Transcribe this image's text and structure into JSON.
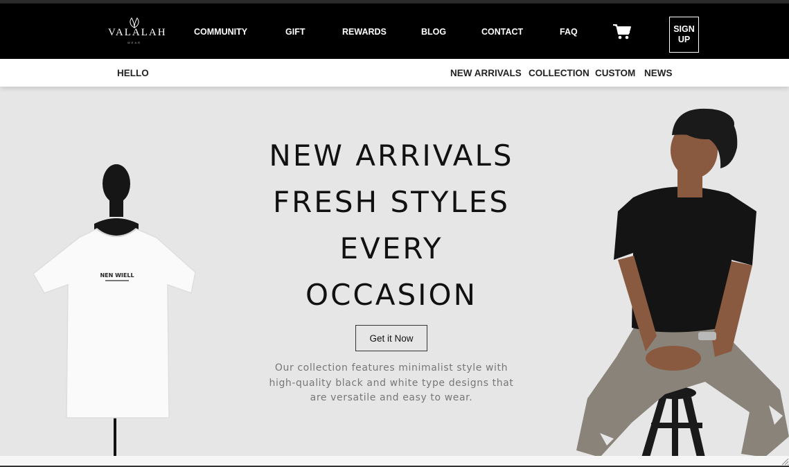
{
  "brand": {
    "name": "VALALAH",
    "tagline": "WEAR"
  },
  "nav": {
    "items": [
      "COMMUNITY",
      "GIFT",
      "REWARDS",
      "BLOG",
      "CONTACT",
      "FAQ"
    ],
    "signup_label": "SIGN UP",
    "cart_icon": "shopping-cart-icon"
  },
  "subnav": {
    "greeting": "HELLO",
    "links": [
      "NEW ARRIVALS",
      "COLLECTION",
      "CUSTOM",
      "NEWS"
    ]
  },
  "hero": {
    "headline": [
      "NEW ARRIVALS",
      "FRESH STYLES",
      "EVERY",
      "OCCASION"
    ],
    "cta_label": "Get it Now",
    "description": "Our collection features minimalist style with high-quality black and white type designs that are versatile and easy to wear.",
    "shirt_print": "NEN WIELL"
  },
  "colors": {
    "header_bg": "#000000",
    "hero_bg": "#e6e6e6",
    "text_dark": "#111111",
    "text_muted": "#777777"
  }
}
